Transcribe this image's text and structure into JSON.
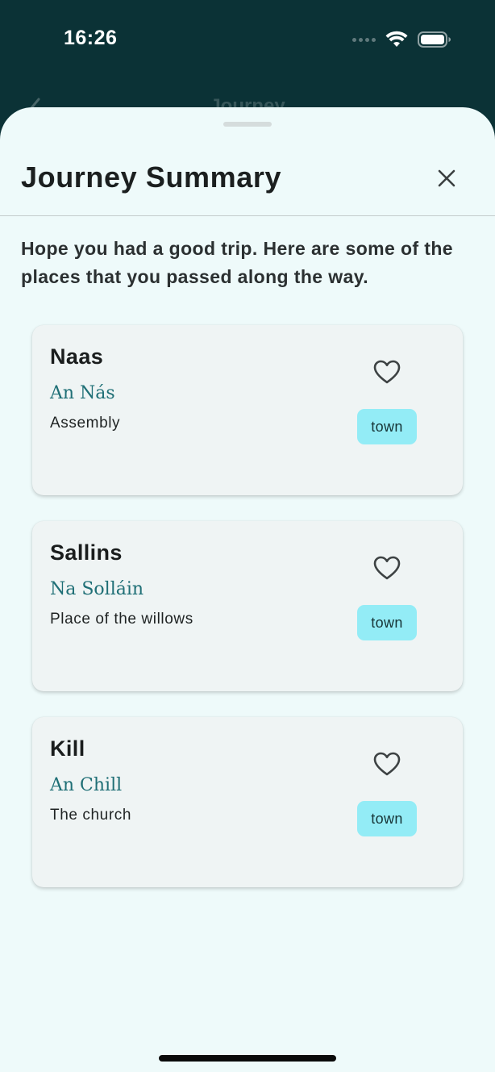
{
  "status_bar": {
    "time": "16:26"
  },
  "underlay": {
    "title": "Journey"
  },
  "sheet": {
    "title": "Journey Summary",
    "intro": "Hope you had a good trip. Here are some of the places that you passed along the way."
  },
  "places": [
    {
      "name": "Naas",
      "irish_name": "An Nás",
      "meaning": "Assembly",
      "type": "town",
      "favorite": false
    },
    {
      "name": "Sallins",
      "irish_name": "Na Solláin",
      "meaning": "Place of the willows",
      "type": "town",
      "favorite": false
    },
    {
      "name": "Kill",
      "irish_name": "An Chill",
      "meaning": "The church",
      "type": "town",
      "favorite": false
    }
  ],
  "icons": {
    "close": "close-icon",
    "favorite": "heart-outline-icon",
    "back": "chevron-left-icon",
    "wifi": "wifi-icon",
    "battery": "battery-icon",
    "signal": "signal-icon"
  },
  "colors": {
    "header_background": "#0b3236",
    "sheet_background": "#eefafa",
    "card_background": "#eff4f4",
    "irish_text": "#1f6f76",
    "badge_background": "#93ecf6"
  }
}
